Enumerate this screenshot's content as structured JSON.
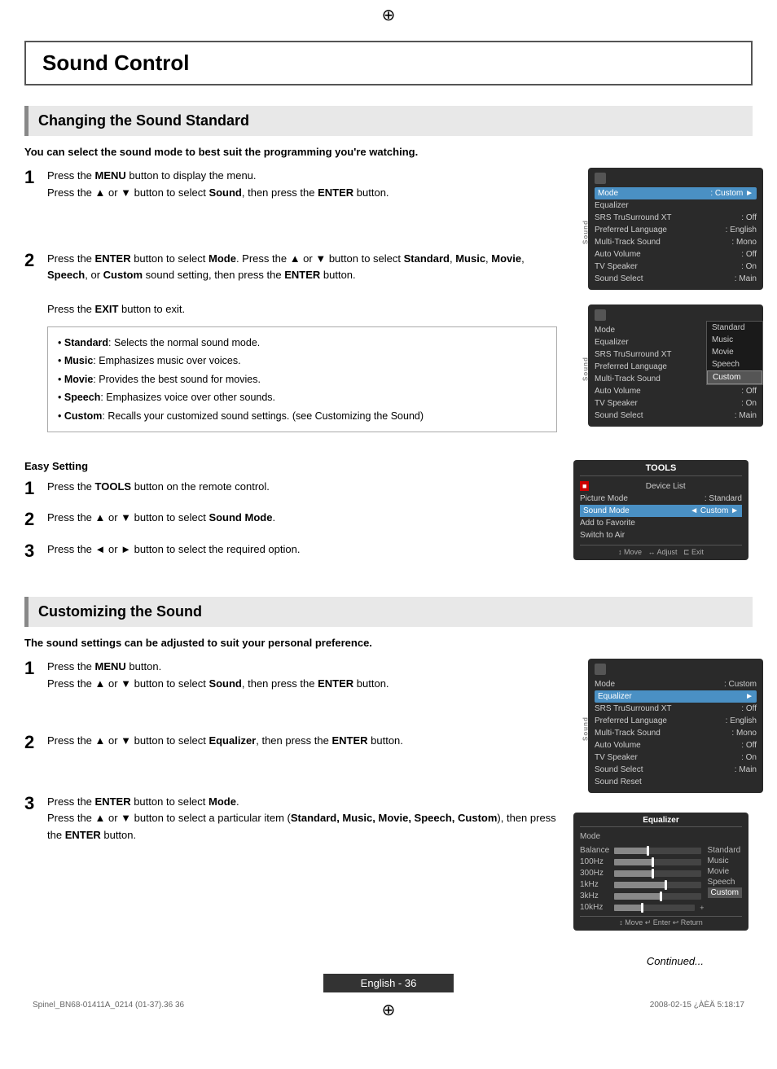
{
  "page": {
    "title": "Sound Control",
    "compass_icon_top": "⊕",
    "compass_icon_bottom": "⊕"
  },
  "section1": {
    "title": "Changing the Sound Standard",
    "subtitle": "You can select the sound mode to best suit the programming you're watching.",
    "step1": {
      "num": "1",
      "text_part1": "Press the ",
      "bold1": "MENU",
      "text_part2": " button to display the menu.",
      "text_part3": "Press the ▲ or ▼ button to select ",
      "bold2": "Sound",
      "text_part4": ", then press the ",
      "bold3": "ENTER",
      "text_part5": " button."
    },
    "step2": {
      "num": "2",
      "text_part1": "Press the ",
      "bold1": "ENTER",
      "text_part2": " button to select ",
      "bold2": "Mode",
      "text_part3": ". Press the ▲ or ▼ button to select ",
      "bold3": "Standard",
      "text_part4": ", ",
      "bold4": "Music",
      "text_part5": ", ",
      "bold5": "Movie",
      "text_part6": ", ",
      "bold6": "Speech",
      "text_part7": ", or ",
      "bold7": "Custom",
      "text_part8": " sound setting, then press the ",
      "bold8": "ENTER",
      "text_part9": " button.",
      "exit_text1": "Press the ",
      "exit_bold": "EXIT",
      "exit_text2": " button to exit."
    },
    "bullets": [
      "Standard: Selects the normal sound mode.",
      "Music: Emphasizes music over voices.",
      "Movie: Provides the best sound for movies.",
      "Speech: Emphasizes voice over other sounds.",
      "Custom: Recalls your customized sound settings. (see Customizing the Sound)"
    ],
    "bullets_bold": [
      "Standard",
      "Music",
      "Movie",
      "Speech",
      "Custom"
    ],
    "easy_setting": {
      "title": "Easy Setting",
      "step1": {
        "num": "1",
        "text1": "Press the ",
        "bold1": "TOOLS",
        "text2": " button on the remote control."
      },
      "step2": {
        "num": "2",
        "text1": "Press the ▲ or ▼ button to select ",
        "bold1": "Sound Mode",
        "text2": "."
      },
      "step3": {
        "num": "3",
        "text1": "Press the ◄ or ► button to select the required option."
      }
    }
  },
  "section2": {
    "title": "Customizing the Sound",
    "subtitle": "The sound settings can be adjusted to suit your personal preference.",
    "step1": {
      "num": "1",
      "text1": "Press the ",
      "bold1": "MENU",
      "text2": " button.",
      "text3": "Press the ▲ or ▼ button to select ",
      "bold2": "Sound",
      "text4": ", then press the ",
      "bold3": "ENTER",
      "text5": " button."
    },
    "step2": {
      "num": "2",
      "text1": "Press the ▲ or ▼ button to select ",
      "bold1": "Equalizer",
      "text2": ", then press the ",
      "bold2": "ENTER",
      "text3": " button."
    },
    "step3": {
      "num": "3",
      "text1": "Press the ",
      "bold1": "ENTER",
      "text2": " button to select ",
      "bold2": "Mode",
      "text3": ".",
      "text4": "Press the ▲ or ▼ button to select a particular item (",
      "bold3": "Standard, Music, Movie, Speech, Custom",
      "text5": "), then press the ",
      "bold4": "ENTER",
      "text6": " button."
    }
  },
  "panel1": {
    "side_label": "Sound",
    "mode_row": {
      "label": "Mode",
      "value": ": Custom"
    },
    "rows": [
      {
        "label": "Equalizer",
        "value": ""
      },
      {
        "label": "SRS TruSurround XT",
        "value": ": Off"
      },
      {
        "label": "Preferred Language",
        "value": ": English"
      },
      {
        "label": "Multi-Track Sound",
        "value": ": Mono"
      },
      {
        "label": "Auto Volume",
        "value": ": Off"
      },
      {
        "label": "TV Speaker",
        "value": ": On"
      },
      {
        "label": "Sound Select",
        "value": ": Main"
      }
    ]
  },
  "panel2": {
    "side_label": "Sound",
    "rows_left": [
      {
        "label": "Mode",
        "value": ""
      },
      {
        "label": "Equalizer",
        "value": ""
      },
      {
        "label": "SRS TruSurround XT",
        "value": ""
      },
      {
        "label": "Preferred Language",
        "value": ""
      },
      {
        "label": "Multi-Track Sound",
        "value": ""
      },
      {
        "label": "Auto Volume",
        "value": ": Off"
      },
      {
        "label": "TV Speaker",
        "value": ": On"
      },
      {
        "label": "Sound Select",
        "value": ": Main"
      }
    ],
    "mode_options": [
      "Standard",
      "Music",
      "Movie",
      "Speech",
      "Custom"
    ]
  },
  "tools_panel": {
    "title": "TOOLS",
    "rows": [
      {
        "label": "Device List",
        "icon": true,
        "value": ""
      },
      {
        "label": "Picture Mode",
        "value": ":   Standard",
        "highlighted": false
      },
      {
        "label": "Sound Mode",
        "value": "◄  Custom  ►",
        "highlighted": true
      },
      {
        "label": "Add to Favorite",
        "value": ""
      },
      {
        "label": "Switch to Air",
        "value": ""
      }
    ],
    "nav": "↕ Move   ↔ Adjust   ⊏ Exit"
  },
  "panel3": {
    "side_label": "Sound",
    "mode_row": {
      "label": "Mode",
      "value": ": Custom"
    },
    "rows": [
      {
        "label": "Equalizer",
        "value": "",
        "highlighted": true
      },
      {
        "label": "SRS TruSurround XT",
        "value": ": Off"
      },
      {
        "label": "Preferred Language",
        "value": ": English"
      },
      {
        "label": "Multi-Track Sound",
        "value": ": Mono"
      },
      {
        "label": "Auto Volume",
        "value": ": Off"
      },
      {
        "label": "TV Speaker",
        "value": ": On"
      },
      {
        "label": "Sound Select",
        "value": ": Main"
      },
      {
        "label": "Sound Reset",
        "value": ""
      }
    ]
  },
  "eq_panel": {
    "title": "Equalizer",
    "mode_label": "Mode",
    "rows": [
      {
        "label": "Balance",
        "fill": 40,
        "handle": 38
      },
      {
        "label": "100Hz",
        "fill": 45,
        "handle": 43
      },
      {
        "label": "300Hz",
        "fill": 45,
        "handle": 43
      },
      {
        "label": "1kHz",
        "fill": 60,
        "handle": 58
      },
      {
        "label": "3kHz",
        "fill": 55,
        "handle": 53
      },
      {
        "label": "10kHz",
        "fill": 35,
        "handle": 33
      }
    ],
    "options": [
      "Standard",
      "Music",
      "Movie",
      "Speech",
      "Custom"
    ],
    "selected_option": "Custom",
    "nav": "↕ Move   ↵ Enter   ↩ Return"
  },
  "footer": {
    "continued_text": "Continued...",
    "page_label": "English - 36",
    "meta_left": "Spinel_BN68-01411A_0214 (01-37).36  36",
    "meta_right": "2008-02-15  ¿ÀÈÄ 5:18:17"
  }
}
